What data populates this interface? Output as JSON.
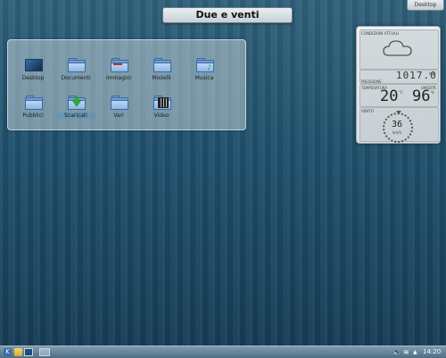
{
  "top": {
    "clock_title": "Due e venti",
    "desktop_button": "Desktop"
  },
  "folderview": {
    "items": [
      {
        "label": "Desktop",
        "icon": "desktop-icon"
      },
      {
        "label": "Documenti",
        "icon": "folder-icon"
      },
      {
        "label": "Immagini",
        "icon": "pictures-folder-icon"
      },
      {
        "label": "Modelli",
        "icon": "folder-icon"
      },
      {
        "label": "Musica",
        "icon": "music-folder-icon"
      },
      {
        "label": "Pubblici",
        "icon": "folder-icon"
      },
      {
        "label": "Scaricati",
        "icon": "download-folder-icon"
      },
      {
        "label": "Vari",
        "icon": "folder-icon"
      },
      {
        "label": "Video",
        "icon": "video-folder-icon"
      }
    ]
  },
  "weather": {
    "conditions_label": "CONDIZIONI ATTUALI",
    "pressure_label": "PRESSIONE",
    "pressure_value": "1017.0",
    "pressure_unit": "hPa",
    "temp_label": "TEMPERATURA",
    "temp_value": "20",
    "temp_unit": "°C",
    "humidity_label": "UMIDITÀ",
    "humidity_value": "96",
    "humidity_unit": "%",
    "wind_label": "VENTO",
    "wind_value": "36",
    "wind_unit": "km/h"
  },
  "taskbar": {
    "time": "14:20"
  },
  "colors": {
    "accent": "#2f607a",
    "folder": "#6f9fd4",
    "download": "#2eaa34"
  }
}
